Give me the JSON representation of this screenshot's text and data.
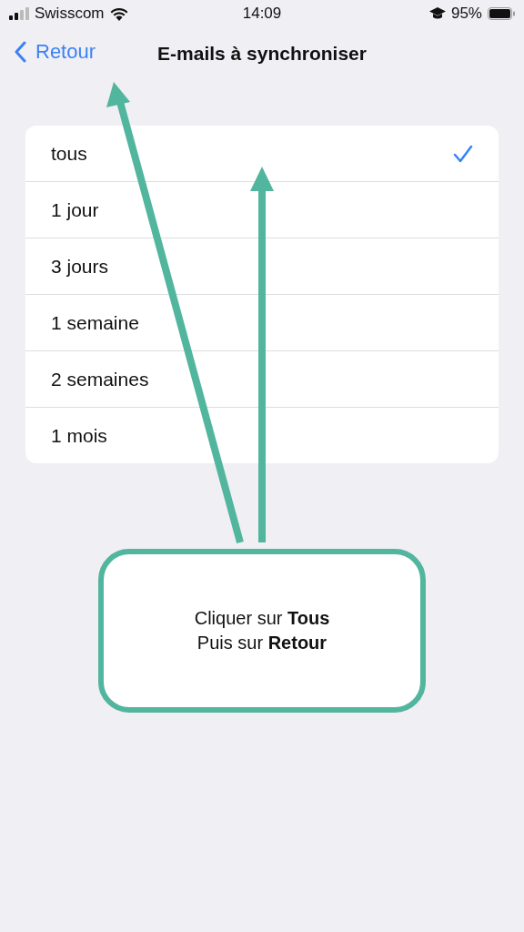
{
  "status_bar": {
    "carrier": "Swisscom",
    "time": "14:09",
    "battery": "95%"
  },
  "nav": {
    "back": "Retour",
    "title": "E-mails à synchroniser"
  },
  "options": [
    {
      "label": "tous",
      "selected": true
    },
    {
      "label": "1 jour",
      "selected": false
    },
    {
      "label": "3 jours",
      "selected": false
    },
    {
      "label": "1 semaine",
      "selected": false
    },
    {
      "label": "2 semaines",
      "selected": false
    },
    {
      "label": "1 mois",
      "selected": false
    }
  ],
  "callout": {
    "lines": [
      "Cliquer sur **Tous**",
      "Puis sur **Retour**"
    ]
  }
}
